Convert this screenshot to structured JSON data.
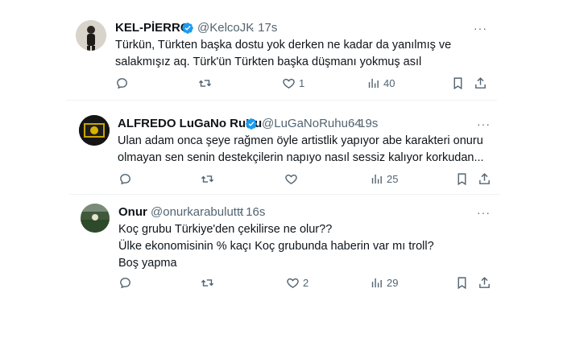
{
  "tweets": [
    {
      "name": "KEL-PİERRO",
      "handle": "@KelcoJK",
      "time": "· 17s",
      "lines": [
        "Türkün, Türkten başka dostu yok derken ne kadar da yanılmış ve",
        "salakmışız aq. Türk'ün Türkten başka düşmanı yokmuş asıl"
      ],
      "likes": "1",
      "views": "40",
      "verified": true
    },
    {
      "name": "ALFREDO LuGaNo RuHu",
      "handle": "@LuGaNoRuhu64",
      "time": "· 19s",
      "lines": [
        "Ulan adam onca şeye rağmen öyle artistlik yapıyor abe karakteri onuru",
        "olmayan sen senin destekçilerin napıyo nasıl sessiz kalıyor korkudan..."
      ],
      "likes": "",
      "views": "25",
      "verified": true
    },
    {
      "name": "Onur",
      "handle": "@onurkarabuluttt",
      "time": "· 16s",
      "lines": [
        "Koç grubu Türkiye'den çekilirse ne olur??",
        "Ülke ekonomisinin % kaçı Koç grubunda haberin var mı troll?",
        "Boş yapma"
      ],
      "likes": "2",
      "views": "29",
      "verified": false
    }
  ],
  "more_label": "···",
  "colors": {
    "verified": "#1d9bf0",
    "muted": "#536471",
    "text": "#0f1419"
  }
}
